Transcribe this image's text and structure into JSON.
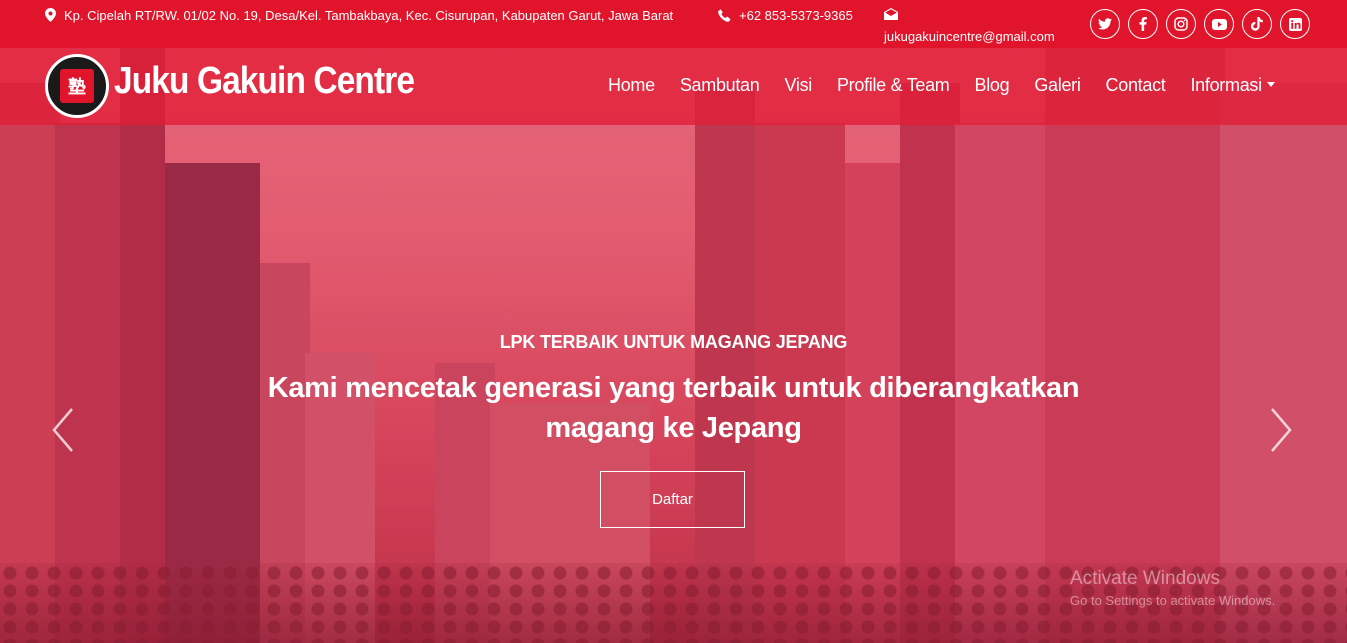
{
  "topbar": {
    "address": "Kp. Cipelah RT/RW. 01/02 No. 19, Desa/Kel. Tambakbaya, Kec. Cisurupan, Kabupaten Garut, Jawa Barat",
    "phone": "+62 853-5373-9365",
    "email": "jukugakuincentre@gmail.com",
    "address_icon": "map-pin-icon",
    "phone_icon": "phone-icon",
    "email_icon": "envelope-icon",
    "socials": [
      "twitter-icon",
      "facebook-icon",
      "instagram-icon",
      "youtube-icon",
      "tiktok-icon",
      "linkedin-icon"
    ]
  },
  "navbar": {
    "brand": "Juku Gakuin Centre",
    "logo_char": "塾",
    "items": [
      "Home",
      "Sambutan",
      "Visi",
      "Profile & Team",
      "Blog",
      "Galeri",
      "Contact",
      "Informasi"
    ]
  },
  "hero": {
    "eyebrow": "LPK TERBAIK UNTUK MAGANG JEPANG",
    "headline": "Kami mencetak generasi yang terbaik untuk diberangkatkan magang ke Jepang",
    "cta_label": "Daftar"
  },
  "watermark": {
    "title": "Activate Windows",
    "subtitle": "Go to Settings to activate Windows."
  },
  "colors": {
    "brand_red": "#e0142b",
    "overlay": "#e22846"
  }
}
